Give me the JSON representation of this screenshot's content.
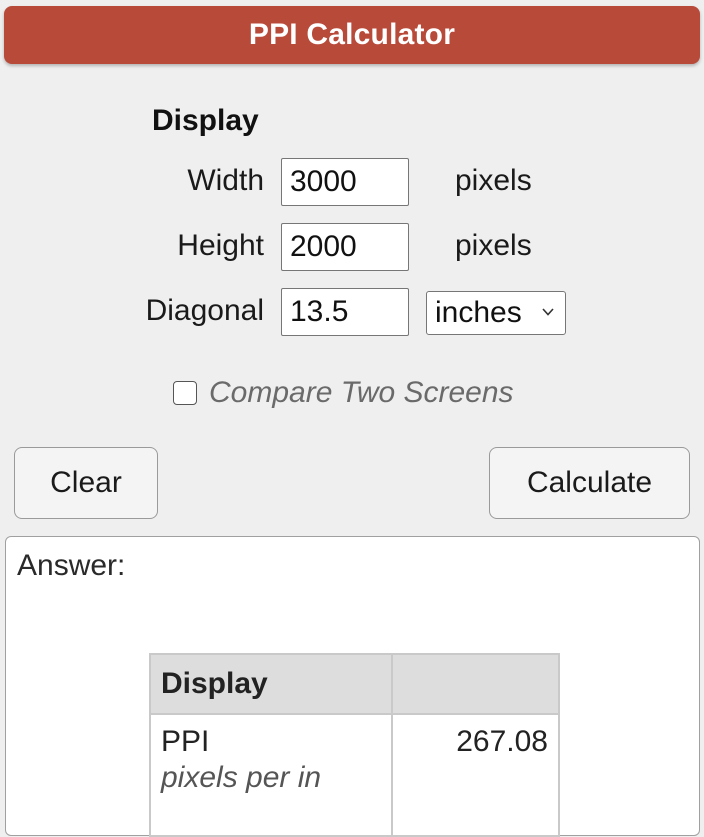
{
  "header": {
    "title": "PPI Calculator"
  },
  "form": {
    "section_title": "Display",
    "width": {
      "label": "Width",
      "value": "3000",
      "unit": "pixels"
    },
    "height": {
      "label": "Height",
      "value": "2000",
      "unit": "pixels"
    },
    "diagonal": {
      "label": "Diagonal",
      "value": "13.5",
      "unit_selected": "inches"
    },
    "compare_label": "Compare Two Screens",
    "compare_checked": false
  },
  "buttons": {
    "clear": "Clear",
    "calculate": "Calculate"
  },
  "answer": {
    "label": "Answer:",
    "table": {
      "header": "Display",
      "header_value": "",
      "row_label": "PPI",
      "row_sublabel": "pixels per in",
      "row_value": "267.08"
    }
  },
  "colors": {
    "title_bar": "#b84a3a",
    "page_bg": "#efefef"
  }
}
